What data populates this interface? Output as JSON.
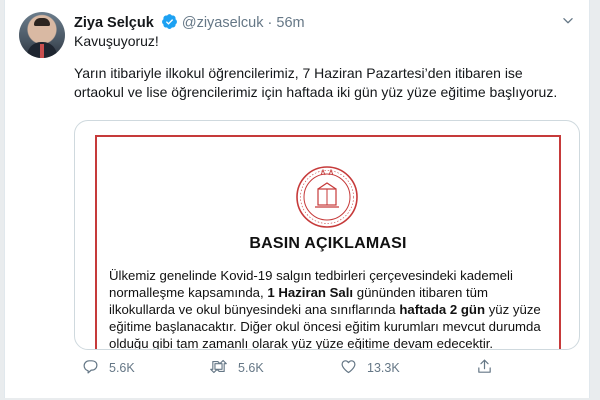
{
  "author": {
    "name": "Ziya Selçuk",
    "handle": "@ziyaselcuk",
    "separator": "·",
    "time": "56m"
  },
  "tweet": {
    "line1": "Kavuşuyoruz!",
    "text": "Yarın itibariyle ilkokul öğrencilerimiz, 7 Haziran Pazartesi’den itibaren ise ortaokul ve lise öğrencilerimiz için haftada iki gün yüz yüze eğitime başlıyoruz."
  },
  "media": {
    "title": "BASIN AÇIKLAMASI",
    "seg1": "Ülkemiz genelinde Kovid-19 salgın tedbirleri çerçevesindeki kademeli normalleşme kapsamında, ",
    "bold1": "1 Haziran Salı",
    "seg2": " gününden itibaren tüm ilkokullarda ve okul bünyesindeki ana sınıflarında ",
    "bold2": "haftada 2 gün",
    "seg3": " yüz yüze eğitime başlanacaktır. Diğer okul öncesi eğitim kurumları mevcut durumda olduğu gibi tam zamanlı olarak yüz yüze eğitime devam edecektir."
  },
  "actions": {
    "replies": "5.6K",
    "retweets": "5.6K",
    "likes": "13.3K"
  },
  "colors": {
    "verified": "#1da1f2",
    "doc_border": "#c63a3a",
    "muted": "#657786"
  }
}
